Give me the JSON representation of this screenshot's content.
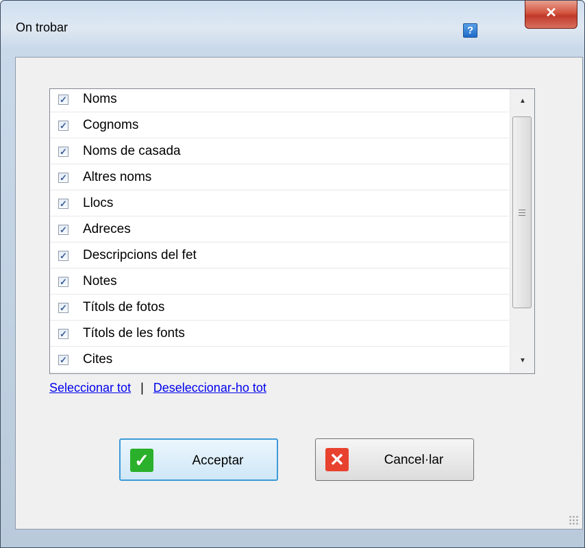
{
  "window": {
    "title": "On trobar"
  },
  "icons": {
    "help": "help-icon",
    "close": "close-icon",
    "checkbox": "checkmark-icon"
  },
  "items": [
    {
      "label": "Noms",
      "checked": true
    },
    {
      "label": "Cognoms",
      "checked": true
    },
    {
      "label": "Noms de casada",
      "checked": true
    },
    {
      "label": "Altres noms",
      "checked": true
    },
    {
      "label": "Llocs",
      "checked": true
    },
    {
      "label": "Adreces",
      "checked": true
    },
    {
      "label": "Descripcions del fet",
      "checked": true
    },
    {
      "label": "Notes",
      "checked": true
    },
    {
      "label": "Títols de fotos",
      "checked": true
    },
    {
      "label": "Títols de les fonts",
      "checked": true
    },
    {
      "label": "Cites",
      "checked": true
    }
  ],
  "links": {
    "select_all": "Seleccionar tot",
    "separator": "|",
    "deselect_all": "Deseleccionar-ho tot"
  },
  "buttons": {
    "ok": "Acceptar",
    "cancel": "Cancel·lar"
  },
  "colors": {
    "ok_icon": "#2bb02b",
    "cancel_icon": "#e8412e",
    "link": "#0000ee"
  }
}
